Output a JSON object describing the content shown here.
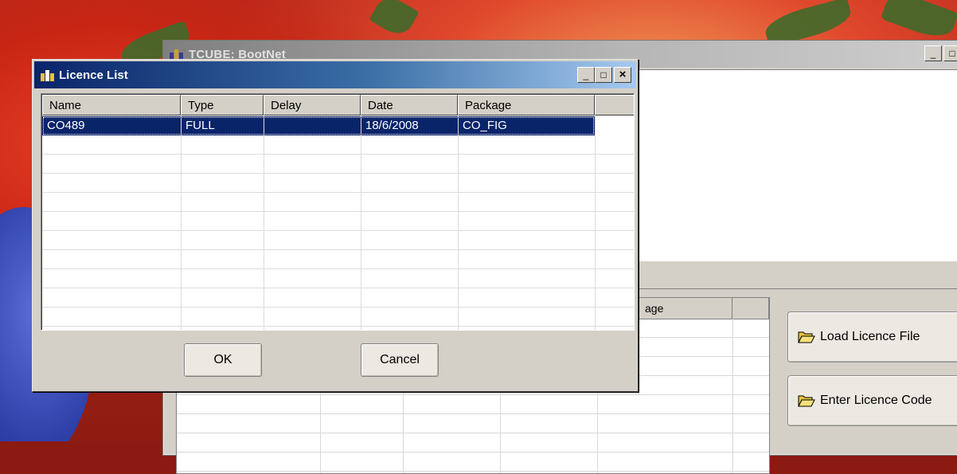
{
  "main_window": {
    "title": "TCUBE: BootNet",
    "bg_table_header_fragment": "age"
  },
  "side_buttons": {
    "load_licence_file": "Load Licence File",
    "enter_licence_code": "Enter Licence Code"
  },
  "dialog": {
    "title": "Licence List",
    "columns": [
      "Name",
      "Type",
      "Delay",
      "Date",
      "Package"
    ],
    "rows": [
      {
        "name": "CO489",
        "type": "FULL",
        "delay": "",
        "date": "18/6/2008",
        "package": "CO_FIG",
        "selected": true
      }
    ],
    "ok_label": "OK",
    "cancel_label": "Cancel"
  },
  "titlebar_buttons": {
    "minimize": "_",
    "maximize": "□",
    "close": "×"
  },
  "colors": {
    "selection": "#0a246a",
    "active_title_start": "#0a246a",
    "active_title_end": "#a6caf0",
    "inactive_title_start": "#7f7f7f",
    "face": "#d4d0c8"
  }
}
